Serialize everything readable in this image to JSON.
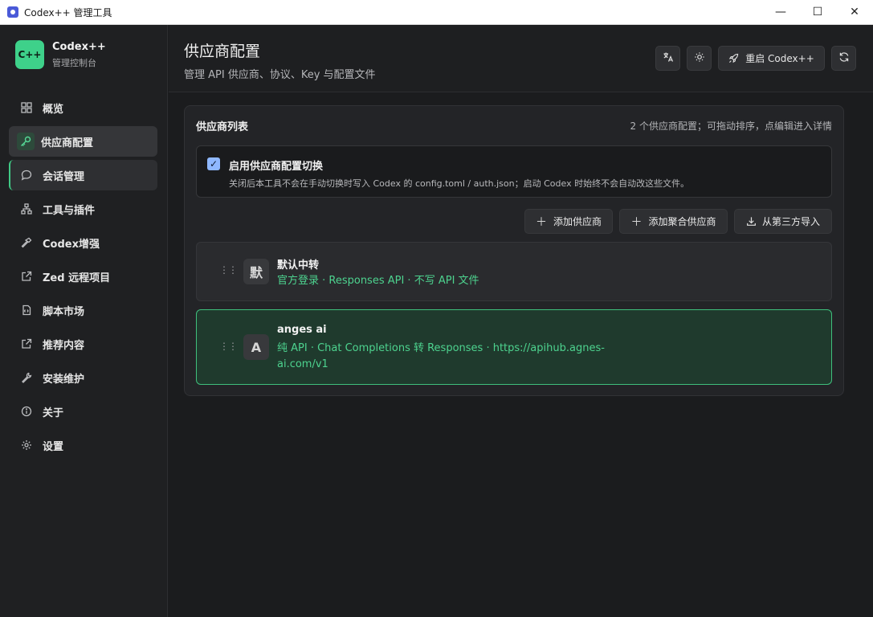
{
  "window": {
    "title": "Codex++ 管理工具",
    "minimize": "—",
    "maximize": "☐",
    "close": "✕"
  },
  "brand": {
    "logo": "C++",
    "name": "Codex++",
    "subtitle": "管理控制台"
  },
  "sidebar": {
    "items": [
      {
        "label": "概览",
        "icon": "grid-icon"
      },
      {
        "label": "供应商配置",
        "icon": "key-icon"
      },
      {
        "label": "会话管理",
        "icon": "chat-icon"
      },
      {
        "label": "工具与插件",
        "icon": "nodes-icon"
      },
      {
        "label": "Codex增强",
        "icon": "hammer-icon"
      },
      {
        "label": "Zed 远程项目",
        "icon": "external-link-icon"
      },
      {
        "label": "脚本市场",
        "icon": "script-icon"
      },
      {
        "label": "推荐内容",
        "icon": "external-link-icon"
      },
      {
        "label": "安装维护",
        "icon": "wrench-icon"
      },
      {
        "label": "关于",
        "icon": "info-icon"
      },
      {
        "label": "设置",
        "icon": "gear-icon"
      }
    ]
  },
  "header": {
    "title": "供应商配置",
    "subtitle": "管理 API 供应商、协议、Key 与配置文件",
    "restart_label": "重启 Codex++"
  },
  "card": {
    "title": "供应商列表",
    "hint": "2 个供应商配置；可拖动排序，点编辑进入详情",
    "toggle": {
      "label": "启用供应商配置切换",
      "description": "关闭后本工具不会在手动切换时写入 Codex 的 config.toml / auth.json；启动 Codex 时始终不会自动改这些文件。",
      "checked": true
    },
    "actions": {
      "add_provider": "添加供应商",
      "add_aggregate": "添加聚合供应商",
      "import": "从第三方导入"
    },
    "providers": [
      {
        "avatar": "默",
        "name": "默认中转",
        "description": "官方登录 · Responses API · 不写 API 文件"
      },
      {
        "avatar": "A",
        "name": "anges ai",
        "description_line1": "纯 API · Chat Completions 转 Responses · https://apihub.agnes-",
        "description_line2": "ai.com/v1"
      }
    ]
  },
  "colors": {
    "accent": "#3ed18a",
    "selected_bg": "#1f3a2d",
    "checkbox": "#8fb8ff"
  }
}
